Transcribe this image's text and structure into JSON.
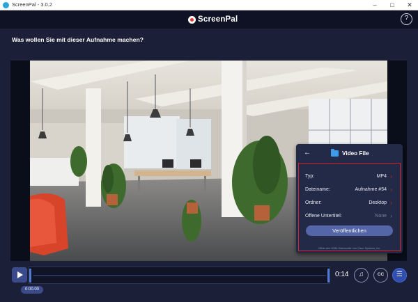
{
  "window": {
    "title": "ScreenPal - 3.0.2",
    "minimize": "–",
    "maximize": "□",
    "close": "✕"
  },
  "header": {
    "logo_text": "ScreenPal",
    "help": "?"
  },
  "question": "Was wollen Sie mit dieser Aufnahme machen?",
  "panel": {
    "back": "←",
    "title": "Video File",
    "rows": [
      {
        "label": "Typ:",
        "value": "MP4"
      },
      {
        "label": "Dateiname:",
        "value": "Aufnahme #54"
      },
      {
        "label": "Ordner:",
        "value": "Desktop"
      },
      {
        "label": "Offene Untertitel:",
        "value": "None"
      }
    ],
    "chevron": "›",
    "publish_label": "Veröffentlichen",
    "footnote": "Offnet den H264-Videocoder von Cisco Systems, Inc."
  },
  "player": {
    "timecode": "0:00.00",
    "duration": "0:14",
    "note_icon": "♫",
    "cc_label": "CC",
    "menu_icon": "☰"
  },
  "colors": {
    "accent": "#d9212b",
    "button": "#5566a8",
    "background": "#1b2038"
  }
}
